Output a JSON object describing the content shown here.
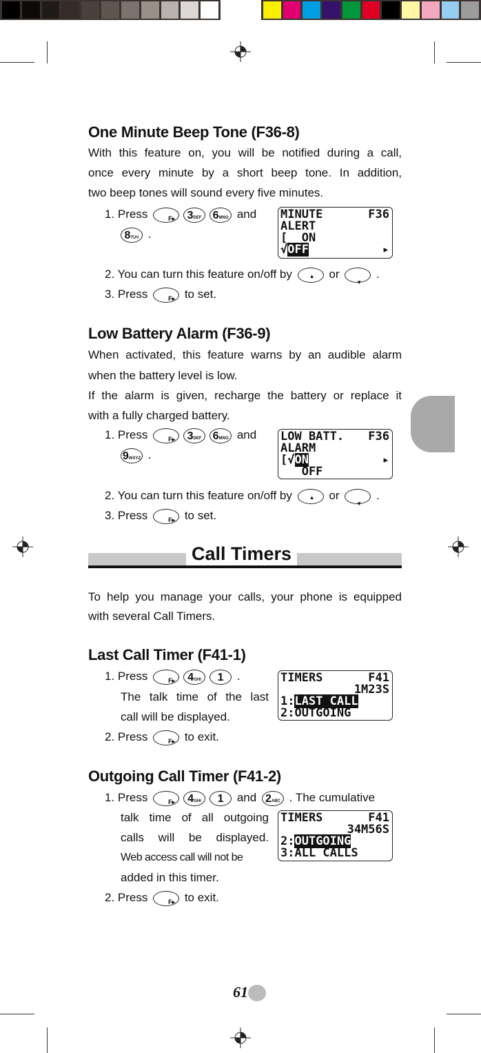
{
  "colors": {
    "grays": [
      "#000000",
      "#0d0a0a",
      "#1e1b19",
      "#352b28",
      "#4b403b",
      "#5f5650",
      "#7d736e",
      "#9a908a",
      "#bab2ad",
      "#dcd8d5",
      "#ffffff"
    ],
    "process": [
      "#f8f000",
      "#e0006f",
      "#009fe3",
      "#35116a",
      "#009639",
      "#e00024",
      "#000000",
      "#fff7a5",
      "#f4a8c0",
      "#96cdf0",
      "#9c9c9c"
    ],
    "tab": "#a9a9a9"
  },
  "s1": {
    "title": "One Minute Beep Tone (F36-8)",
    "para": [
      "With this feature on, you will be notified during a call,",
      "once every minute by a short beep tone. In addition,",
      "two beep tones will sound every five minutes."
    ],
    "step1": "1.  Press",
    "and": "and",
    "dot": ".",
    "step2": "2.  You can turn this feature on/off by",
    "or": "or",
    "step3": "3.  Press",
    "toset": "to set.",
    "lcd": {
      "l1": "MINUTE",
      "l1r": "F36",
      "l2": "ALERT",
      "l3": "[  ON",
      "l4a": "√",
      "l4": "OFF"
    }
  },
  "s2": {
    "title": "Low Battery Alarm (F36-9)",
    "para": [
      "When activated, this feature warns by an audible alarm",
      "when the battery level is low.",
      "If the alarm is given, recharge the battery or replace it",
      "with a fully charged battery."
    ],
    "step1": "1.  Press",
    "and": "and",
    "dot": ".",
    "step2": "2.  You can turn this feature on/off by",
    "or": "or",
    "step3": "3.  Press",
    "toset": "to set.",
    "lcd": {
      "l1": "LOW BATT.",
      "l1r": "F36",
      "l2": "ALARM",
      "l3a": "√",
      "l3": "ON",
      "l4": "   OFF"
    }
  },
  "section": {
    "title": "Call Timers",
    "para": [
      "To help you manage your calls, your phone is equipped",
      "with several Call Timers."
    ]
  },
  "s3": {
    "title": "Last Call Timer (F41-1)",
    "step1": "1.  Press",
    "dot": ".",
    "l2": "The  talk  time  of  the  last",
    "l3": "call will be displayed.",
    "step2": "2.  Press",
    "toexit": "to exit.",
    "lcd": {
      "l1": "TIMERS",
      "l1r": "F41",
      "l2": "1M23S",
      "l3a": "1:",
      "l3": "LAST CALL",
      "l4": "2:OUTGOING"
    }
  },
  "s4": {
    "title": "Outgoing Call Timer (F41-2)",
    "step1": "1.  Press",
    "and": "and",
    "tail": ". The cumulative",
    "lines": [
      "talk  time  of  all  outgoing",
      "calls  will  be  displayed.",
      "Web access call will not be",
      "added in this timer."
    ],
    "step2": "2.  Press",
    "toexit": "to exit.",
    "lcd": {
      "l1": "TIMERS",
      "l1r": "F41",
      "l2": "34M56S",
      "l3a": "2:",
      "l3": "OUTGOING",
      "l4": "3:ALL CALLS"
    }
  },
  "keys": {
    "f": "F▸",
    "k3": "3",
    "k3s": "DEF",
    "k6": "6",
    "k6s": "MNO",
    "k8": "8",
    "k8s": "TUV",
    "k9": "9",
    "k9s": "WXYZ",
    "k4": "4",
    "k4s": "GHI",
    "k1": "1",
    "k2": "2",
    "k2s": "ABC",
    "up": "▲",
    "down": "▼"
  },
  "page_number": "61"
}
